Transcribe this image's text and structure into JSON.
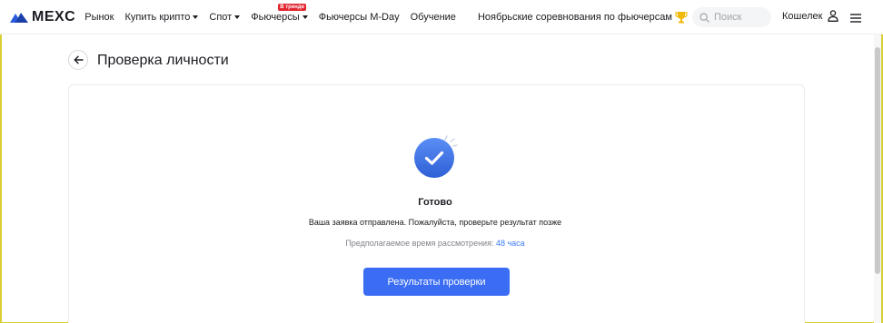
{
  "navbar": {
    "logo_text": "MEXC",
    "items": [
      {
        "label": "Рынок",
        "dropdown": false
      },
      {
        "label": "Купить крипто",
        "dropdown": true
      },
      {
        "label": "Спот",
        "dropdown": true
      },
      {
        "label": "Фьючерсы",
        "dropdown": true,
        "badge": "В тренде"
      },
      {
        "label": "Фьючерсы M-Day",
        "dropdown": false
      },
      {
        "label": "Обучение",
        "dropdown": false
      }
    ],
    "promo_label": "Ноябрьские соревнования по фьючерсам",
    "search_placeholder": "Поиск",
    "wallet_label": "Кошелек"
  },
  "page": {
    "title": "Проверка личности"
  },
  "result": {
    "status_title": "Готово",
    "status_message": "Ваша заявка отправлена. Пожалуйста, проверьте результат позже",
    "review_prefix": "Предполагаемое время рассмотрения:",
    "review_time": "48 часа",
    "button_label": "Результаты проверки"
  },
  "colors": {
    "accent": "#3a6cf4",
    "link": "#3e7bfa",
    "badge": "#e1252f",
    "trophy": "#f0b90b",
    "logo_blue": "#2a5ada"
  }
}
